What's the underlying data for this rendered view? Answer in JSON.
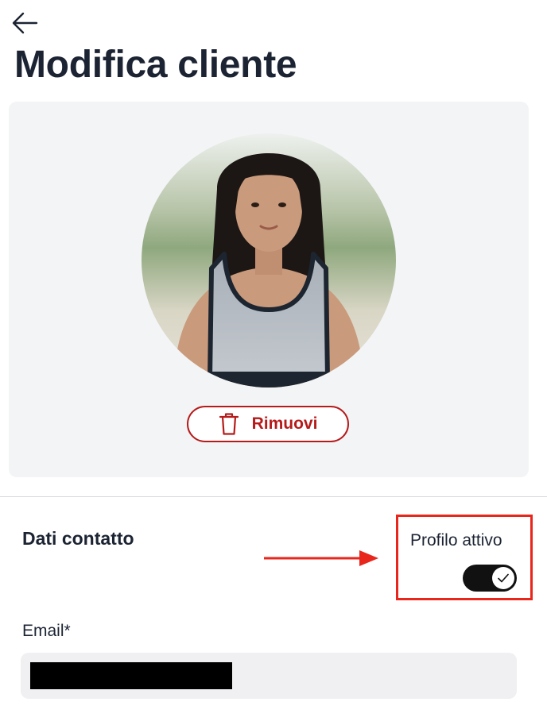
{
  "header": {
    "title": "Modifica cliente"
  },
  "icons": {
    "back": "arrow-left-icon",
    "trash": "trash-icon",
    "check": "check-icon",
    "annotation": "arrow-right-icon"
  },
  "photo": {
    "remove_label": "Rimuovi"
  },
  "contact": {
    "section_title": "Dati contatto",
    "active_label": "Profilo attivo",
    "active": true,
    "email_label": "Email*",
    "email_value_redacted": true
  },
  "colors": {
    "danger": "#b61b1b",
    "annotation": "#e8261c",
    "toggle_on": "#111111",
    "card_bg": "#f3f4f6",
    "input_bg": "#f0f0f2"
  }
}
